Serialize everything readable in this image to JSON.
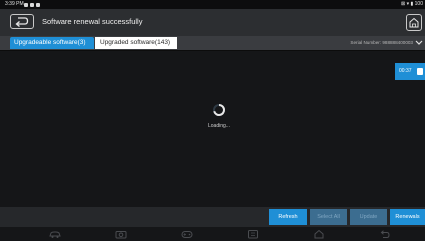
{
  "statusbar": {
    "time": "3:39 PM",
    "right": "⊠ ▾ ▮ 100"
  },
  "header": {
    "title": "Software renewal successfully"
  },
  "tabs": [
    {
      "label": "Upgradeable software(3)"
    },
    {
      "label": "Upgraded software(143)"
    }
  ],
  "serial": {
    "text": "Serial Number: 988888400003"
  },
  "timer": {
    "text": "00:37"
  },
  "loading": {
    "text": "Loading..."
  },
  "actions": {
    "refresh": "Refresh",
    "select_all": "Select All",
    "update": "Update",
    "renewals": "Renewals"
  },
  "colors": {
    "accent": "#1f8fd6",
    "disabled": "#3c6d90",
    "background": "#151618"
  },
  "icons": [
    "back-icon",
    "home-icon",
    "chevron-down-icon",
    "car-icon",
    "camera-icon",
    "gamepad-icon",
    "screenshot-icon",
    "house-icon",
    "return-icon"
  ]
}
